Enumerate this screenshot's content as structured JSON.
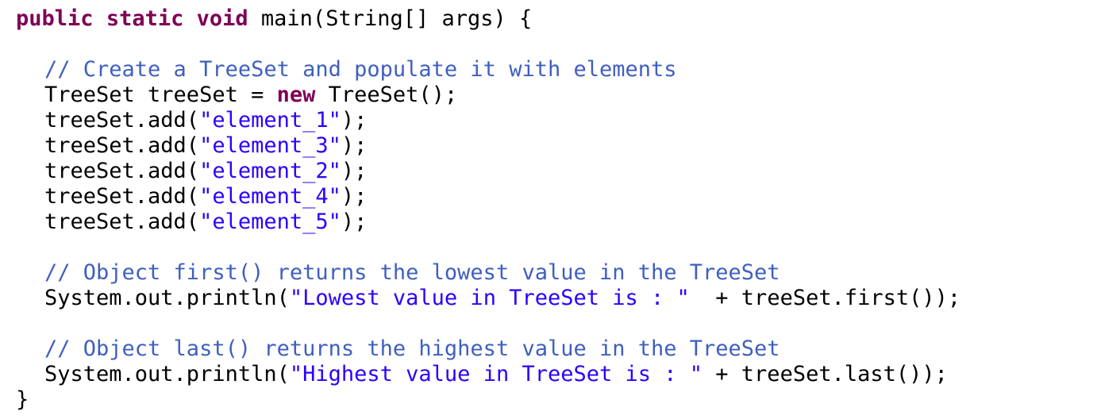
{
  "colors": {
    "keyword": "#7f0055",
    "comment": "#3f5fbf",
    "string": "#2a00ff",
    "plain": "#000000"
  },
  "lines": {
    "l1": {
      "kw1": "public",
      "kw2": "static",
      "kw3": "void",
      "rest": " main(String[] args) {"
    },
    "l2": {
      "comment": "// Create a TreeSet and populate it with elements"
    },
    "l3": {
      "pre": "TreeSet treeSet = ",
      "kw": "new",
      "post": " TreeSet();"
    },
    "l4": {
      "pre": "treeSet.add(",
      "str": "\"element_1\"",
      "post": ");"
    },
    "l5": {
      "pre": "treeSet.add(",
      "str": "\"element_3\"",
      "post": ");"
    },
    "l6": {
      "pre": "treeSet.add(",
      "str": "\"element_2\"",
      "post": ");"
    },
    "l7": {
      "pre": "treeSet.add(",
      "str": "\"element_4\"",
      "post": ");"
    },
    "l8": {
      "pre": "treeSet.add(",
      "str": "\"element_5\"",
      "post": ");"
    },
    "l9": {
      "comment": "// Object first() returns the lowest value in the TreeSet"
    },
    "l10": {
      "pre": "System.out.println(",
      "str": "\"Lowest value in TreeSet is : \"",
      "post": "  + treeSet.first());"
    },
    "l11": {
      "comment": "// Object last() returns the highest value in the TreeSet"
    },
    "l12": {
      "pre": "System.out.println(",
      "str": "\"Highest value in TreeSet is : \"",
      "post": " + treeSet.last());"
    },
    "l13": {
      "text": "}"
    }
  }
}
